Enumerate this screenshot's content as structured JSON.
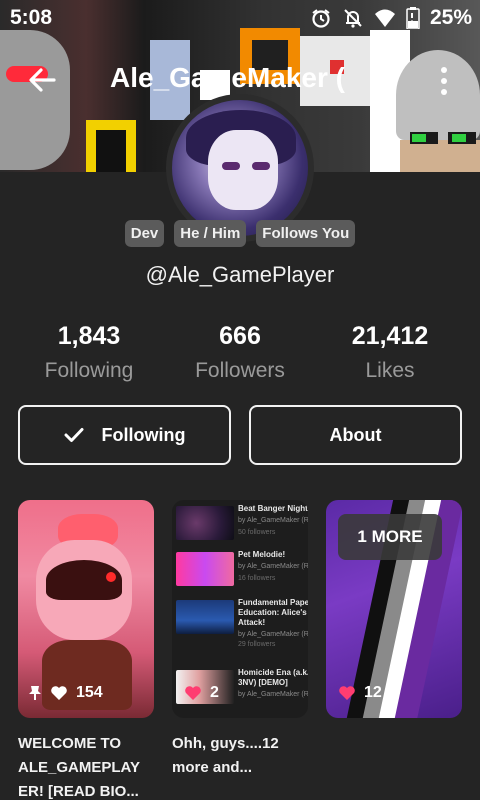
{
  "status_bar": {
    "time": "5:08",
    "battery": "25%",
    "icons": [
      "alarm-icon",
      "notifications-off-icon",
      "wifi-icon",
      "battery-icon"
    ]
  },
  "header": {
    "title": "Ale_GameMaker (",
    "back_icon": "arrow-left-icon",
    "menu_icon": "more-vertical-icon"
  },
  "profile": {
    "badges": [
      "Dev",
      "He / Him",
      "Follows You"
    ],
    "handle": "@Ale_GamePlayer",
    "stats": [
      {
        "value": "1,843",
        "label": "Following"
      },
      {
        "value": "666",
        "label": "Followers"
      },
      {
        "value": "21,412",
        "label": "Likes"
      }
    ]
  },
  "actions": {
    "following_label": "Following",
    "about_label": "About"
  },
  "cards": [
    {
      "likes": "154",
      "pinned": true,
      "caption": "WELCOME TO\nALE_GAMEPLAY\nER! [READ BIO..."
    },
    {
      "likes": "2",
      "caption": "Ohh, guys....12\nmore and...",
      "collection": [
        {
          "title": "Beat Banger Night..",
          "author": "by Ale_GameMaker (R..",
          "followers": "50 followers"
        },
        {
          "title": "Pet Melodie!",
          "author": "by Ale_GameMaker (R..",
          "followers": "16 followers"
        },
        {
          "title": "Fundamental Paper",
          "title2": "Education: Alice's",
          "title3": "Attack!",
          "author": "by Ale_GameMaker (R..",
          "followers": "29 followers"
        },
        {
          "title": "Homicide Ena (a.k.a",
          "title2": "3NV) [DEMO]",
          "author": "by Ale_GameMaker (R..",
          "followers": ""
        }
      ]
    },
    {
      "likes": "12",
      "more_label": "1 MORE",
      "caption": ""
    }
  ],
  "colors": {
    "background": "#242424",
    "badge": "#5b5b5b",
    "heart": "#ff3d71",
    "muted_text": "#9a9a9a"
  }
}
